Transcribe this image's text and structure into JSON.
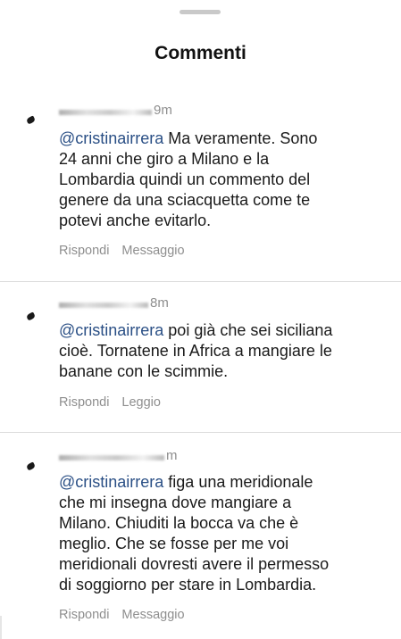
{
  "header": {
    "title": "Commenti"
  },
  "comments": [
    {
      "time": "9m",
      "mention": "@cristinairrera",
      "text": " Ma veramente. Sono\n24 anni che giro a Milano e la\nLombardia quindi un commento del\ngenere da una sciacquetta come te\npotevi anche evitarlo.",
      "reply_label": "Rispondi",
      "message_label": "Messaggio"
    },
    {
      "time": "8m",
      "mention": "@cristinairrera",
      "text": "  poi già che sei siciliana\ncioè. Tornatene in Africa a mangiare le\nbanane con le scimmie.",
      "reply_label": "Rispondi",
      "message_label": "Leggio"
    },
    {
      "time": "m",
      "mention": "@cristinairrera",
      "text": "  figa una meridionale\nche mi insegna dove mangiare a\nMilano. Chiuditi la bocca va che è\nmeglio. Che se fosse per me voi\nmeridionali dovresti avere il permesso\ndi soggiorno per stare in Lombardia.",
      "reply_label": "Rispondi",
      "message_label": "Messaggio"
    }
  ]
}
